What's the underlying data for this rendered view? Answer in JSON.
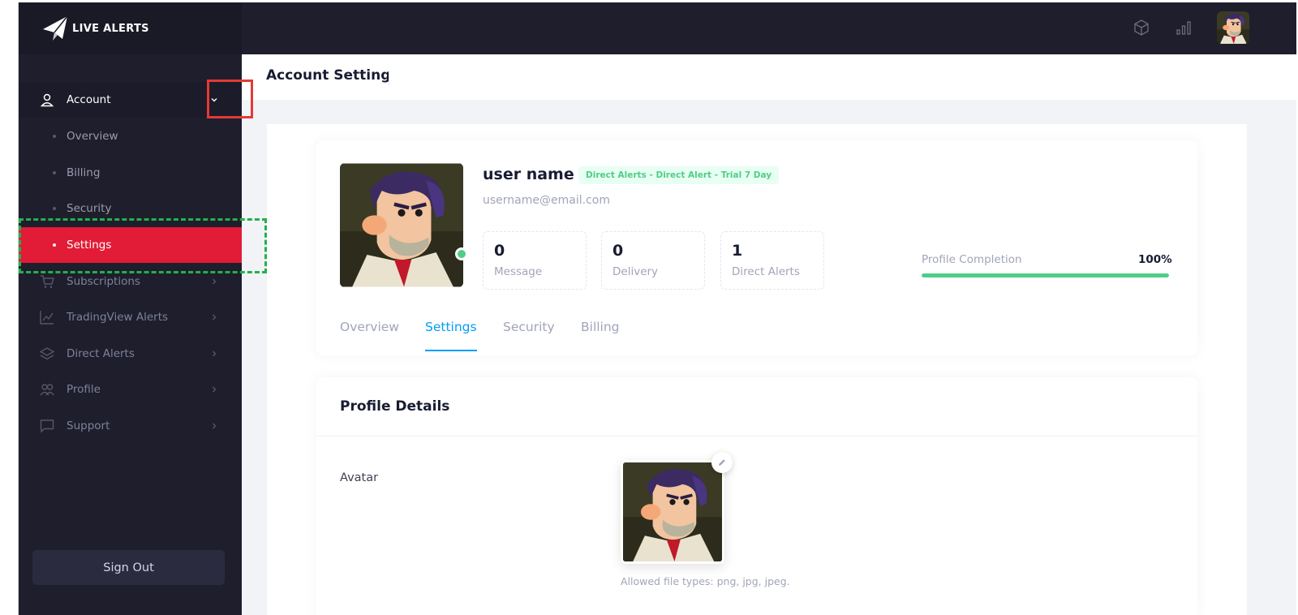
{
  "app": {
    "logo_text": "LIVE ALERTS"
  },
  "sidebar": {
    "account_label": "Account",
    "sub_items": [
      {
        "label": "Overview"
      },
      {
        "label": "Billing"
      },
      {
        "label": "Security"
      },
      {
        "label": "Settings"
      }
    ],
    "items": [
      {
        "label": "Subscriptions",
        "icon": "cart-icon"
      },
      {
        "label": "TradingView Alerts",
        "icon": "chart-line-icon"
      },
      {
        "label": "Direct Alerts",
        "icon": "layers-icon"
      },
      {
        "label": "Profile",
        "icon": "users-icon"
      },
      {
        "label": "Support",
        "icon": "message-icon"
      }
    ],
    "sign_out_label": "Sign Out"
  },
  "header": {
    "page_title": "Account Setting"
  },
  "profile": {
    "name": "user name",
    "plan_badge": "Direct Alerts - Direct Alert - Trial 7 Day",
    "email": "username@email.com",
    "online_status_color": "#50cd89",
    "stats": [
      {
        "value": "0",
        "label": "Message"
      },
      {
        "value": "0",
        "label": "Delivery"
      },
      {
        "value": "1",
        "label": "Direct Alerts"
      }
    ],
    "completion_label": "Profile Completion",
    "completion_value": "100%",
    "completion_fraction": 1.0
  },
  "tabs": [
    {
      "label": "Overview"
    },
    {
      "label": "Settings"
    },
    {
      "label": "Security"
    },
    {
      "label": "Billing"
    }
  ],
  "active_tab": "Settings",
  "profile_details": {
    "title": "Profile Details",
    "avatar_label": "Avatar",
    "file_hint": "Allowed file types: png, jpg, jpeg."
  },
  "colors": {
    "sidebar_bg": "#1e1e2d",
    "active_item": "#e21b36",
    "primary": "#009ef7",
    "success": "#50cd89"
  }
}
